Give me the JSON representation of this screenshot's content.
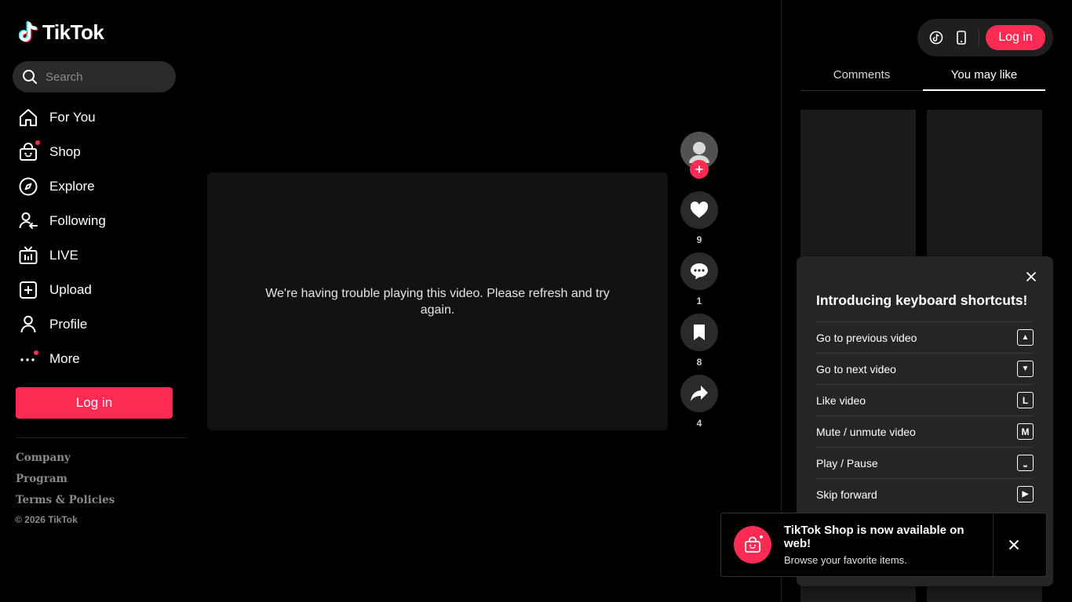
{
  "brand": {
    "name": "TikTok",
    "accent": "#fe2c55"
  },
  "search": {
    "placeholder": "Search"
  },
  "nav": [
    {
      "label": "For You",
      "icon": "home-icon"
    },
    {
      "label": "Shop",
      "icon": "shopping-bag-icon"
    },
    {
      "label": "Explore",
      "icon": "compass-icon"
    },
    {
      "label": "Following",
      "icon": "user-follow-icon"
    },
    {
      "label": "LIVE",
      "icon": "live-tv-icon"
    },
    {
      "label": "Upload",
      "icon": "plus-square-icon"
    },
    {
      "label": "Profile",
      "icon": "person-icon"
    },
    {
      "label": "More",
      "icon": "more-dots-icon"
    }
  ],
  "sidebar": {
    "login_label": "Log in",
    "footer_links": [
      "Company",
      "Program",
      "Terms & Policies"
    ],
    "copyright": "© 2026 TikTok"
  },
  "video": {
    "error_message": "We're having trouble playing this video. Please refresh and try again."
  },
  "actions": {
    "like_count": "9",
    "comment_count": "1",
    "save_count": "8",
    "share_count": "4"
  },
  "header": {
    "login_label": "Log in"
  },
  "tabs": [
    {
      "label": "Comments",
      "active": false
    },
    {
      "label": "You may like",
      "active": true
    }
  ],
  "shortcuts": {
    "title": "Introducing keyboard shortcuts!",
    "items": [
      {
        "label": "Go to previous video",
        "key": "▲"
      },
      {
        "label": "Go to next video",
        "key": "▼"
      },
      {
        "label": "Like video",
        "key": "L"
      },
      {
        "label": "Mute / unmute video",
        "key": "M"
      },
      {
        "label": "Play / Pause",
        "key": "⎵"
      },
      {
        "label": "Skip forward",
        "key": "▶"
      }
    ]
  },
  "toast": {
    "title": "TikTok Shop is now available on web!",
    "subtitle": "Browse your favorite items."
  }
}
